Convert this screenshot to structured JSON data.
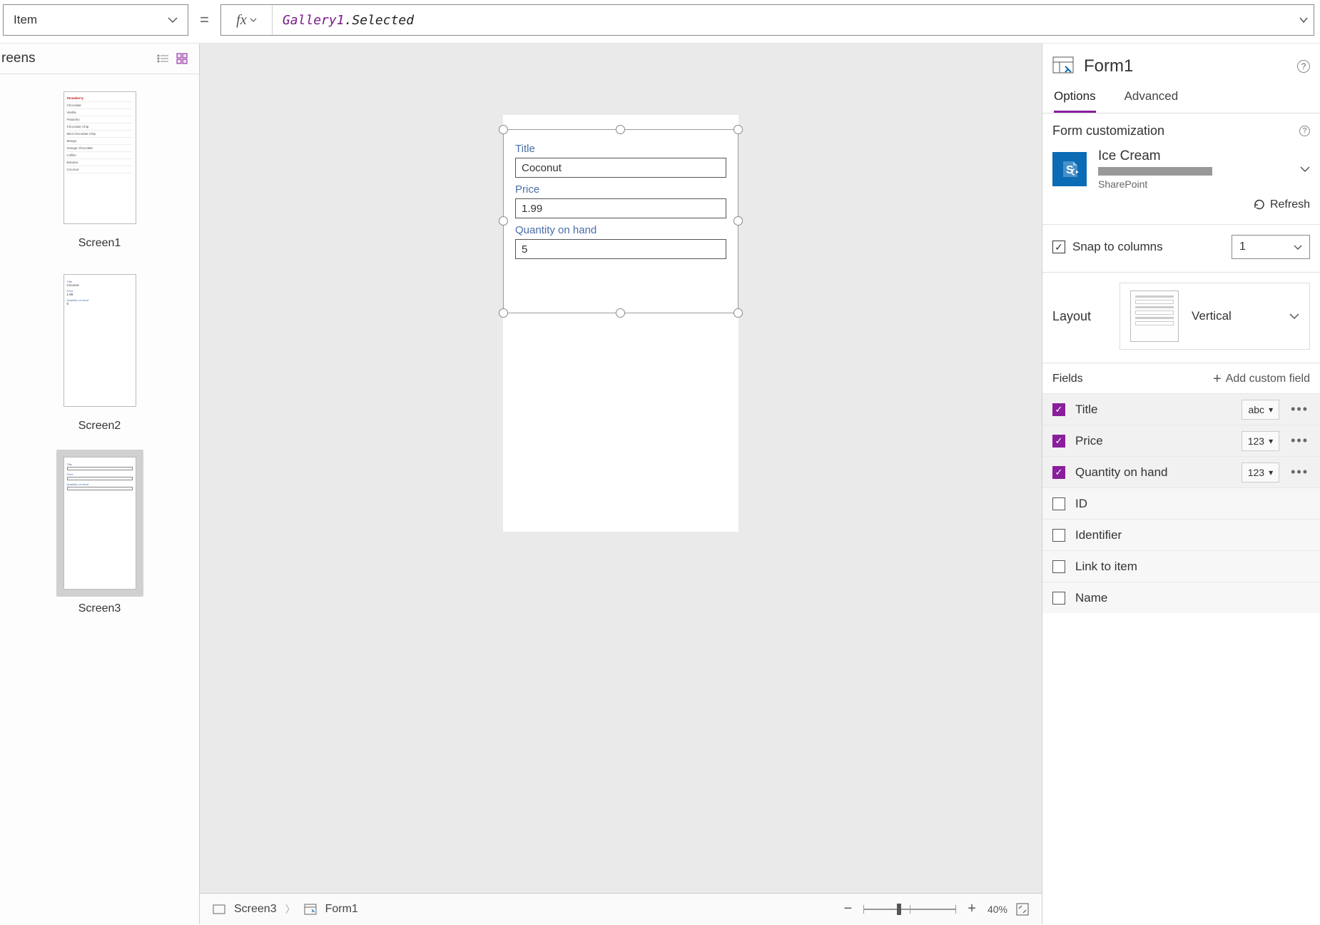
{
  "formula": {
    "property": "Item",
    "fx_label": "fx",
    "gallery_ref": "Gallery1",
    "selected": ".Selected"
  },
  "leftpane": {
    "header": "reens",
    "thumb1": {
      "rows": [
        "Strawberry",
        "Chocolate",
        "Vanilla",
        "Pistachio",
        "Chocolate Chip",
        "Mint Chocolate Chip",
        "Mango",
        "Orange Chocolate",
        "Coffee",
        "Banana",
        "Coconut"
      ]
    },
    "thumb2": {
      "label_title": "Title",
      "val_title": "Coconut",
      "label_price": "Price",
      "val_price": "1.99",
      "label_qty": "Quantity on hand",
      "val_qty": "5"
    },
    "screen_labels": {
      "s1": "Screen1",
      "s2": "Screen2",
      "s3": "Screen3"
    }
  },
  "canvas": {
    "fields": {
      "title_label": "Title",
      "title_value": "Coconut",
      "price_label": "Price",
      "price_value": "1.99",
      "qty_label": "Quantity on hand",
      "qty_value": "5"
    }
  },
  "breadcrumb": {
    "screen": "Screen3",
    "form": "Form1",
    "zoom": "40%"
  },
  "rightpane": {
    "title": "Form1",
    "tab_options": "Options",
    "tab_advanced": "Advanced",
    "form_custom": "Form customization",
    "ds_name": "Ice Cream",
    "ds_source": "SharePoint",
    "refresh": "Refresh",
    "snap": "Snap to columns",
    "snap_val": "1",
    "layout": "Layout",
    "layout_val": "Vertical",
    "fields_label": "Fields",
    "add_field": "Add custom field",
    "fields": {
      "f1": {
        "name": "Title",
        "type": "abc"
      },
      "f2": {
        "name": "Price",
        "type": "123"
      },
      "f3": {
        "name": "Quantity on hand",
        "type": "123"
      },
      "f4": {
        "name": "ID"
      },
      "f5": {
        "name": "Identifier"
      },
      "f6": {
        "name": "Link to item"
      },
      "f7": {
        "name": "Name"
      }
    }
  }
}
